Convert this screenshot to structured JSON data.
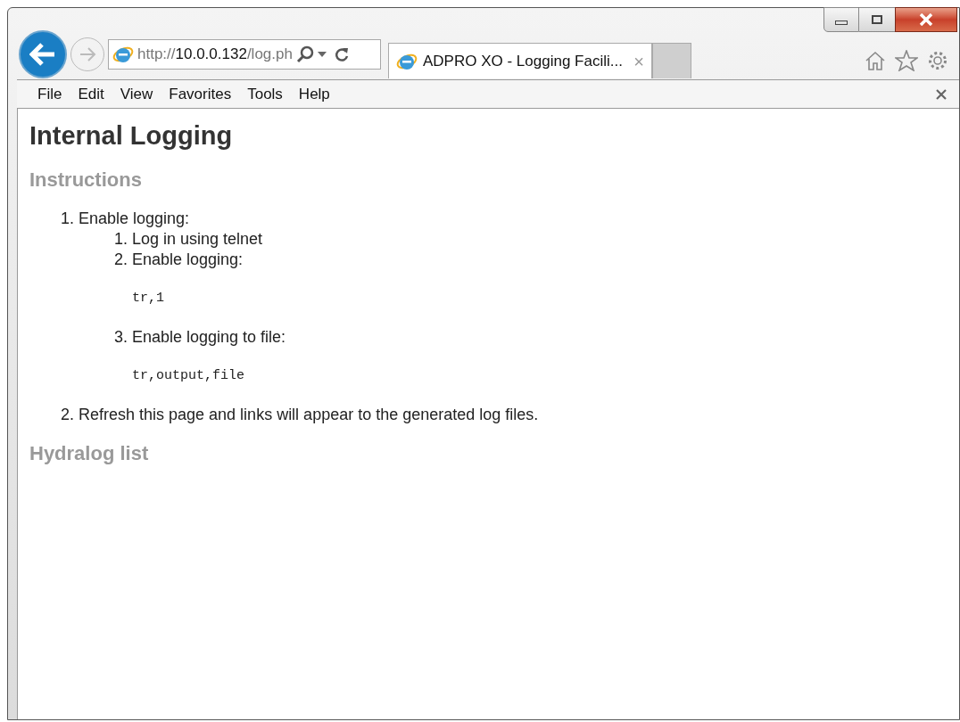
{
  "address_bar": {
    "scheme": "http://",
    "host": "10.0.0.132",
    "path": "/log.ph"
  },
  "tabs": [
    {
      "title": "ADPRO XO - Logging Facili...",
      "close": "×",
      "selected": true
    }
  ],
  "menu": [
    "File",
    "Edit",
    "View",
    "Favorites",
    "Tools",
    "Help"
  ],
  "page": {
    "title": "Internal Logging",
    "sections": [
      {
        "heading": "Instructions",
        "items": [
          {
            "number": "1.",
            "text": "Enable logging:",
            "children": [
              {
                "number": "1.",
                "text": "Log in using telnet"
              },
              {
                "number": "2.",
                "text": "Enable logging:",
                "code": "tr,1"
              },
              {
                "number": "3.",
                "text": "Enable logging to file:",
                "code": "tr,output,file"
              }
            ]
          },
          {
            "number": "2.",
            "text": "Refresh this page and links will appear to the generated log files."
          }
        ]
      },
      {
        "heading": "Hydralog list"
      }
    ]
  }
}
